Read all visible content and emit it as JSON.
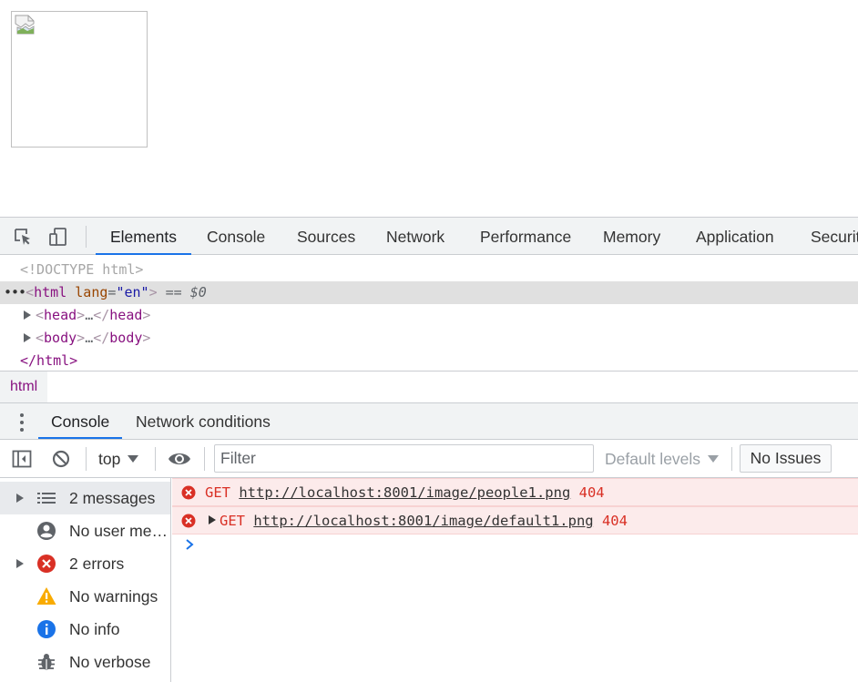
{
  "devtools": {
    "main_tabs": [
      {
        "label": "Elements",
        "active": true
      },
      {
        "label": "Console"
      },
      {
        "label": "Sources"
      },
      {
        "label": "Network"
      },
      {
        "label": "Performance"
      },
      {
        "label": "Memory"
      },
      {
        "label": "Application"
      },
      {
        "label": "Securit"
      }
    ],
    "toolbar_icons": [
      "inspect-element-icon",
      "device-toolbar-icon"
    ]
  },
  "elements_tree": {
    "doctype": "<!DOCTYPE html>",
    "html_tag": "html",
    "html_attr_name": "lang",
    "html_attr_value": "\"en\"",
    "selected_marker": "== $0",
    "children": [
      {
        "tag": "head",
        "ellipsis": "…"
      },
      {
        "tag": "body",
        "ellipsis": "…"
      }
    ],
    "closing_tag": "</html>"
  },
  "breadcrumb": {
    "item": "html"
  },
  "drawer": {
    "tabs": [
      {
        "label": "Console",
        "active": true
      },
      {
        "label": "Network conditions"
      }
    ]
  },
  "console_toolbar": {
    "context": "top",
    "filter_placeholder": "Filter",
    "levels": "Default levels",
    "issues": "No Issues"
  },
  "console_sidebar": {
    "items": [
      {
        "label": "2 messages",
        "icon": "list-icon",
        "expandable": true,
        "selected": true
      },
      {
        "label": "No user messages",
        "icon": "user-icon",
        "expandable": false
      },
      {
        "label": "2 errors",
        "icon": "error-icon",
        "expandable": true
      },
      {
        "label": "No warnings",
        "icon": "warning-icon",
        "expandable": false
      },
      {
        "label": "No info",
        "icon": "info-icon",
        "expandable": false
      },
      {
        "label": "No verbose",
        "icon": "verbose-icon",
        "expandable": false
      }
    ]
  },
  "console_messages": [
    {
      "method": "GET",
      "url": "http://localhost:8001/image/people1.png",
      "status": "404",
      "expandable": false
    },
    {
      "method": "GET",
      "url": "http://localhost:8001/image/default1.png",
      "status": "404",
      "expandable": true
    }
  ],
  "colors": {
    "accent": "#1a73e8",
    "error": "#d93025",
    "error_bg": "#fcebeb",
    "warning": "#f9ab00",
    "info": "#1a73e8"
  }
}
